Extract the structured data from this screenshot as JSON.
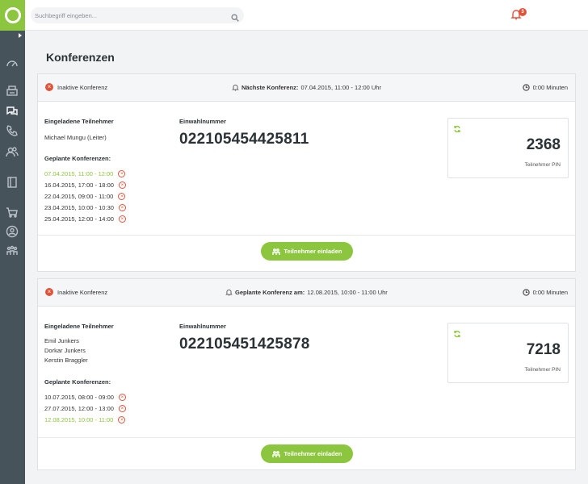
{
  "header": {
    "search_placeholder": "Suchbegriff eingeben...",
    "notification_count": "3"
  },
  "page": {
    "title": "Konferenzen"
  },
  "colors": {
    "accent": "#8cc63f",
    "danger": "#e0533b",
    "sidebar": "#46535a"
  },
  "sidebar": {
    "icons": [
      "dashboard-icon",
      "fax-icon",
      "chat-icon",
      "phone-icon",
      "contacts-icon",
      "book-icon",
      "cart-icon",
      "user-circle-icon",
      "users-icon"
    ]
  },
  "conferences": [
    {
      "status": "Inaktive Konferenz",
      "next_label": "Nächste Konferenz:",
      "next_value": "07.04.2015, 11:00 - 12:00 Uhr",
      "duration": "0:00 Minuten",
      "participants_label": "Eingeladene Teilnehmer",
      "participants": [
        "Michael Mungu (Leiter)"
      ],
      "dial_label": "Einwahlnummer",
      "dial_number": "022105454425811",
      "planned_label": "Geplante Konferenzen:",
      "planned": [
        {
          "text": "07.04.2015, 11:00 - 12:00",
          "highlight": true
        },
        {
          "text": "16.04.2015, 17:00 - 18:00",
          "highlight": false
        },
        {
          "text": "22.04.2015, 09:00 - 11:00",
          "highlight": false
        },
        {
          "text": "23.04.2015, 10:00 - 10:30",
          "highlight": false
        },
        {
          "text": "25.04.2015, 12:00 - 14:00",
          "highlight": false
        }
      ],
      "pin": "2368",
      "pin_label": "Teilnehmer PIN",
      "invite_label": "Teilnehmer einladen"
    },
    {
      "status": "Inaktive Konferenz",
      "next_label": "Geplante Konferenz am:",
      "next_value": "12.08.2015, 10:00 - 11:00 Uhr",
      "duration": "0:00 Minuten",
      "participants_label": "Eingeladene Teilnehmer",
      "participants": [
        "Emil Junkers",
        "Dorkar Junkers",
        "Kerstin Braggler"
      ],
      "dial_label": "Einwahlnummer",
      "dial_number": "022105451425878",
      "planned_label": "Geplante Konferenzen:",
      "planned": [
        {
          "text": "10.07.2015, 08:00 - 09:00",
          "highlight": false
        },
        {
          "text": "27.07.2015, 12:00 - 13:00",
          "highlight": false
        },
        {
          "text": "12.08.2015, 10:00 - 11:00",
          "highlight": true
        }
      ],
      "pin": "7218",
      "pin_label": "Teilnehmer PIN",
      "invite_label": "Teilnehmer einladen"
    }
  ]
}
